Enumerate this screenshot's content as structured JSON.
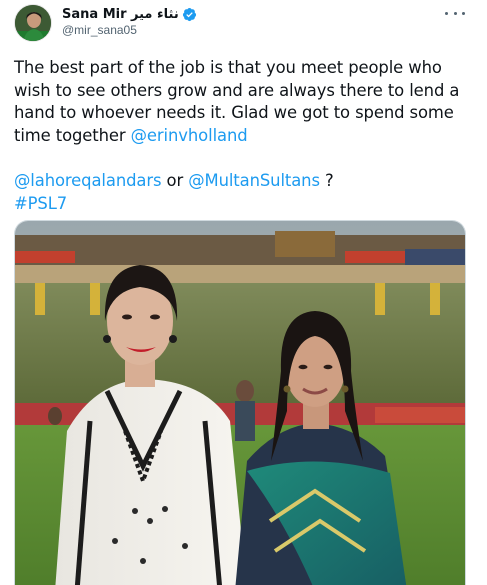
{
  "author": {
    "display_name": "Sana Mir نثاء میر",
    "handle": "@mir_sana05",
    "verified": true
  },
  "tweet": {
    "line1": "The best part of the job is that you meet people who",
    "line2": "wish to see others grow and are always there to lend a",
    "line3": "hand to whoever needs it. Glad we got to spend some",
    "line4_text": "time together ",
    "mention_erin": "@erinvholland",
    "mention_lahore": "@lahoreqalandars",
    "or_text": " or ",
    "mention_multan": "@MultanSultans",
    "question": " ?",
    "hashtag": "#PSL7"
  },
  "icons": {
    "more": "more-horizontal-icon",
    "verified": "verified-badge-icon"
  },
  "colors": {
    "link": "#1d9bf0",
    "text": "#0f1419",
    "secondary": "#536471"
  }
}
